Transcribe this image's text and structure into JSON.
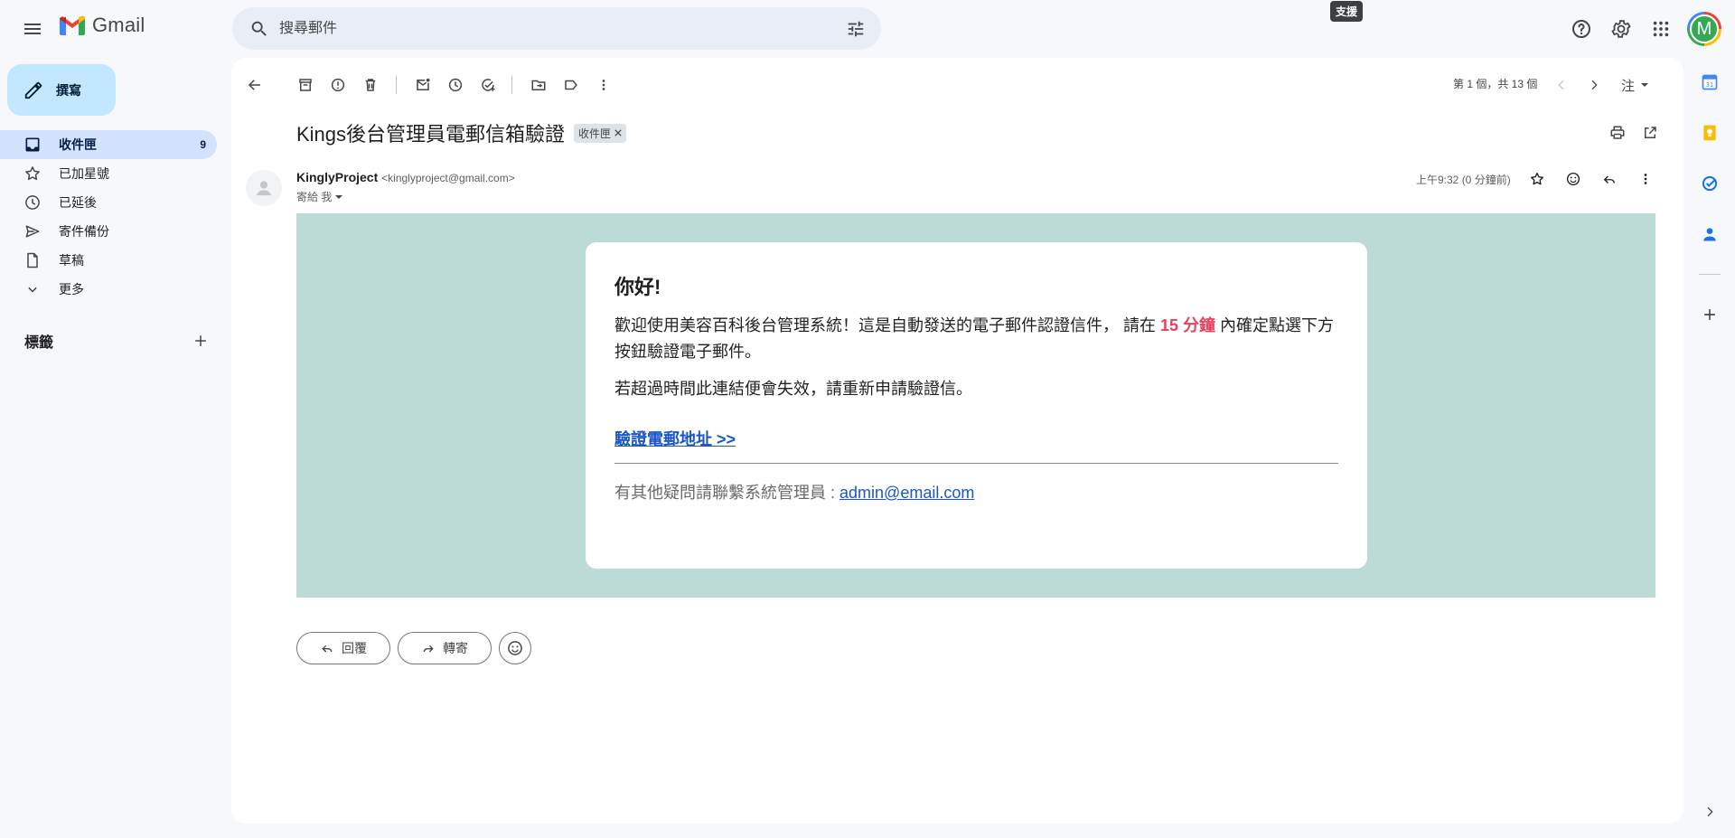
{
  "app": {
    "name": "Gmail"
  },
  "search": {
    "placeholder": "搜尋郵件"
  },
  "tooltip": "支援",
  "avatar_letter": "M",
  "compose_label": "撰寫",
  "nav": [
    {
      "label": "收件匣",
      "count": "9",
      "icon": "inbox-icon",
      "active": true
    },
    {
      "label": "已加星號",
      "icon": "star-icon"
    },
    {
      "label": "已延後",
      "icon": "clock-icon"
    },
    {
      "label": "寄件備份",
      "icon": "send-icon"
    },
    {
      "label": "草稿",
      "icon": "draft-icon"
    },
    {
      "label": "更多",
      "icon": "chevron-down-icon"
    }
  ],
  "labels_header": "標籤",
  "toolbar": {
    "page_info": "第 1 個，共 13 個",
    "input_tool": "注"
  },
  "email": {
    "subject": "Kings後台管理員電郵信箱驗證",
    "chip": "收件匣",
    "sender_name": "KinglyProject",
    "sender_email": "<kinglyproject@gmail.com>",
    "to_label": "寄給 我",
    "time": "上午9:32 (0 分鐘前)",
    "body": {
      "greeting": "你好!",
      "p1_before": "歡迎使用美容百科後台管理系統！這是自動發送的電子郵件認證信件， 請在 ",
      "p1_highlight": "15 分鐘",
      "p1_after": " 內確定點選下方按鈕驗證電子郵件。",
      "p2": "若超過時間此連結便會失效，請重新申請驗證信。",
      "verify_link": "驗證電郵地址 >>",
      "contact_text": "有其他疑問請聯繫系統管理員 : ",
      "contact_email": "admin@email.com"
    }
  },
  "actions": {
    "reply": "回覆",
    "forward": "轉寄"
  },
  "colors": {
    "accent": "#0b57d0",
    "highlight": "#e8415f",
    "body_bg": "#bcdbd6"
  }
}
